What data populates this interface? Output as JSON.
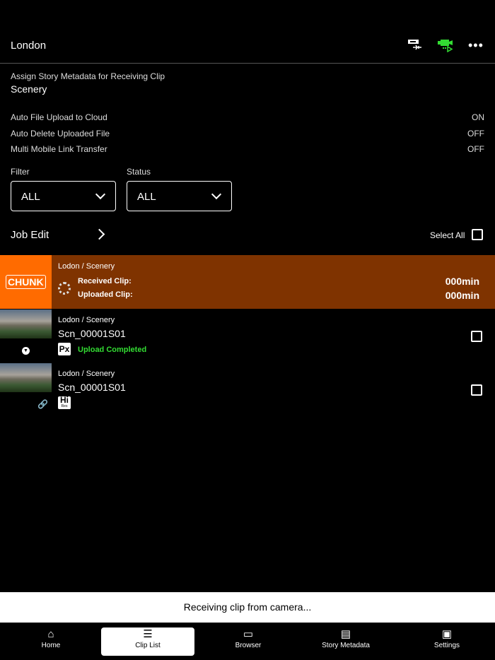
{
  "header": {
    "title": "London"
  },
  "story": {
    "label": "Assign Story Metadata for Receiving Clip",
    "value": "Scenery"
  },
  "settings": [
    {
      "label": "Auto File Upload to Cloud",
      "value": "ON"
    },
    {
      "label": "Auto Delete Uploaded File",
      "value": "OFF"
    },
    {
      "label": "Multi Mobile Link Transfer",
      "value": "OFF"
    }
  ],
  "filter": {
    "label": "Filter",
    "value": "ALL"
  },
  "status": {
    "label": "Status",
    "value": "ALL"
  },
  "job_edit": "Job Edit",
  "select_all": "Select All",
  "receiving": {
    "badge": "CHUNK",
    "path": "Lodon / Scenery",
    "received_label": "Received Clip:",
    "uploaded_label": "Uploaded Clip:",
    "received_value": "000min",
    "uploaded_value": "000min"
  },
  "clips": [
    {
      "path": "Lodon / Scenery",
      "name": "Scn_00001S01",
      "badge": "Px",
      "status": "Upload Completed"
    },
    {
      "path": "Lodon / Scenery",
      "name": "Scn_00001S01",
      "badge": "Hi",
      "badge_sub": "Res"
    }
  ],
  "toast": "Receiving clip from camera...",
  "nav": [
    "Home",
    "Clip List",
    "Browser",
    "Story Metadata",
    "Settings"
  ],
  "colors": {
    "accent_orange": "#ff6b00",
    "row_brown": "#7f3300",
    "green": "#33dd33"
  }
}
